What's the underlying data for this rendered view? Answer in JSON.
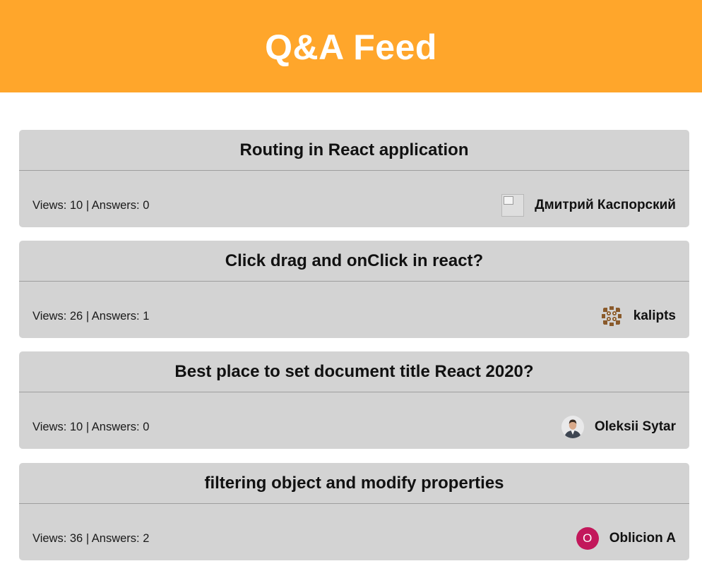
{
  "header": {
    "title": "Q&A Feed",
    "background_color": "#ffa62b"
  },
  "questions": [
    {
      "title": "Routing in React application",
      "stats": "Views: 10 | Answers: 0",
      "views": 10,
      "answers": 0,
      "author": "Дмитрий Каспорский",
      "avatar_type": "broken-image-icon"
    },
    {
      "title": "Click drag and onClick in react?",
      "stats": "Views: 26 | Answers: 1",
      "views": 26,
      "answers": 1,
      "author": "kalipts",
      "avatar_type": "identicon"
    },
    {
      "title": "Best place to set document title React 2020?",
      "stats": "Views: 10 | Answers: 0",
      "views": 10,
      "answers": 0,
      "author": "Oleksii Sytar",
      "avatar_type": "photo"
    },
    {
      "title": "filtering object and modify properties",
      "stats": "Views: 36 | Answers: 2",
      "views": 36,
      "answers": 2,
      "author": "Oblicion A",
      "avatar_type": "letter",
      "avatar_letter": "O",
      "avatar_color": "#c2185b"
    }
  ]
}
